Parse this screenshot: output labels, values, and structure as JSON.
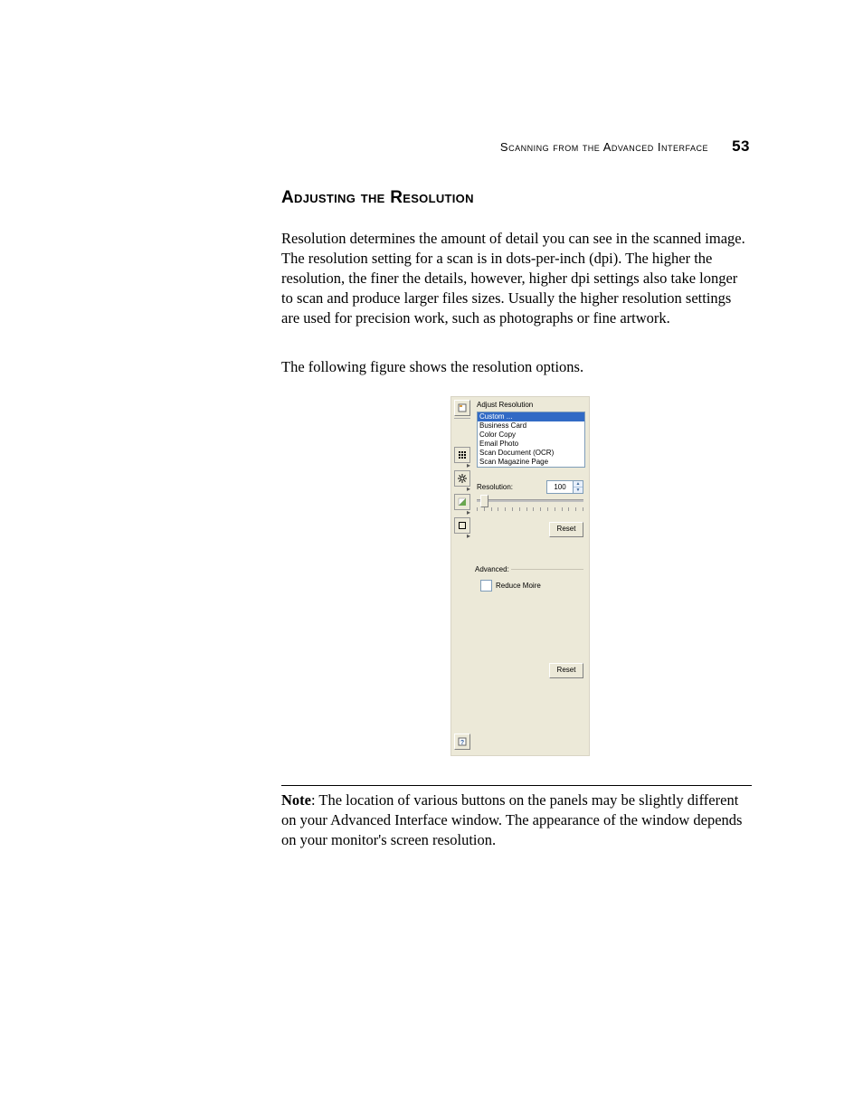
{
  "header": {
    "chapter": "Scanning from the Advanced Interface",
    "page_number": "53"
  },
  "section_title": "Adjusting the Resolution",
  "para1": "Resolution determines the amount of detail you can see in the scanned image. The resolution setting for a scan is in dots-per-inch (dpi). The higher the resolution, the finer the details, however, higher dpi settings also take longer to scan and produce larger files sizes. Usually the higher resolution settings are used for precision work, such as photographs or fine artwork.",
  "para2": "The following figure shows the resolution options.",
  "figure": {
    "panel_title": "Adjust Resolution",
    "presets": [
      "Custom ...",
      "Business Card",
      "Color Copy",
      "Email Photo",
      "Scan Document (OCR)",
      "Scan Magazine Page"
    ],
    "resolution_label": "Resolution:",
    "resolution_value": "100",
    "reset_label": "Reset",
    "advanced_label": "Advanced:",
    "reduce_moire_label": "Reduce Moire",
    "reset_label2": "Reset"
  },
  "note": {
    "bold": "Note",
    "text": ":  The location of various buttons on the panels may be slightly different on your Advanced Interface window. The appearance of the window depends on your monitor's screen resolution."
  }
}
